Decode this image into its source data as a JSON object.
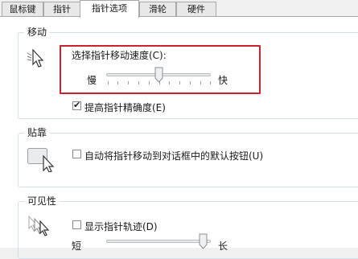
{
  "tabs": [
    {
      "label": "鼠标键",
      "active": false
    },
    {
      "label": "指针",
      "active": false
    },
    {
      "label": "指针选项",
      "active": true
    },
    {
      "label": "滑轮",
      "active": false
    },
    {
      "label": "硬件",
      "active": false
    }
  ],
  "motion": {
    "title": "移动",
    "speed_label": "选择指针移动速度(C):",
    "slow_label": "慢",
    "fast_label": "快",
    "speed_value_fraction": 0.5,
    "enhance_precision": {
      "label": "提高指针精确度(E)",
      "checked": true
    }
  },
  "snap_to": {
    "title": "贴靠",
    "auto_move": {
      "label": "自动将指针移动到对话框中的默认按钮(U)",
      "checked": false
    }
  },
  "visibility": {
    "title": "可见性",
    "trails": {
      "label": "显示指针轨迹(D)",
      "checked": false
    },
    "short_label": "短",
    "long_label": "长",
    "trail_length_fraction": 0.9
  },
  "accent_color": "#c8242b"
}
